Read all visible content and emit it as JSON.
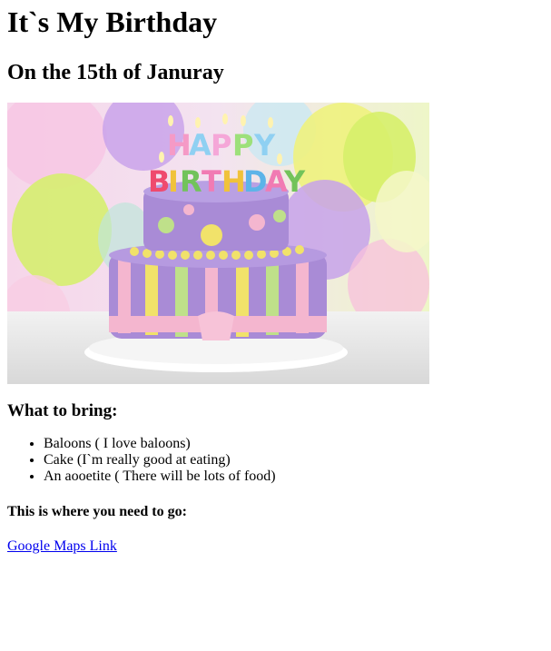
{
  "title": "It`s My Birthday",
  "subtitle": "On the 15th of Januray",
  "image": {
    "alt": "Birthday cake with Happy Birthday candles",
    "candle_letters_top": [
      "H",
      "A",
      "P",
      "P",
      "Y"
    ],
    "candle_letters_bottom": [
      "B",
      "I",
      "R",
      "T",
      "H",
      "D",
      "A",
      "Y"
    ]
  },
  "bring": {
    "heading": "What to bring:",
    "items": [
      "Baloons ( I love baloons)",
      "Cake (I`m really good at eating)",
      "An aooetite ( There will be lots of food)"
    ]
  },
  "location": {
    "heading": "This is where you need to go:",
    "link_text": "Google Maps Link"
  },
  "colors": {
    "link": "#0000ee",
    "cake_purple": "#a98bd6",
    "cake_pink": "#f4b6cf",
    "cake_yellow": "#f1e26a",
    "cake_green": "#bfe08a"
  }
}
